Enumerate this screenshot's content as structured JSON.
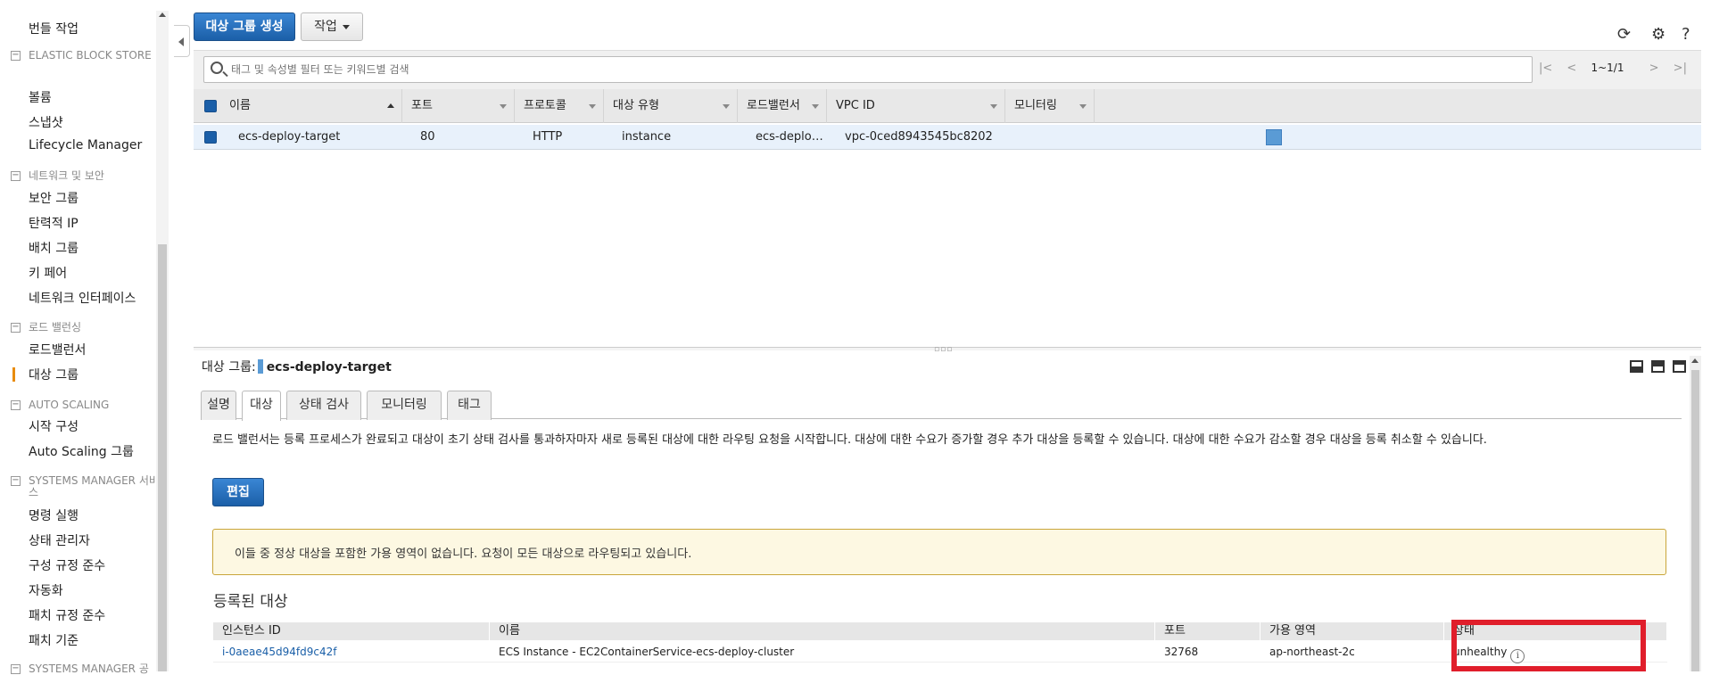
{
  "sidebar": {
    "items": [
      {
        "label": "번들 작업"
      },
      {
        "label": "볼륨"
      },
      {
        "label": "스냅샷"
      },
      {
        "label": "Lifecycle Manager"
      },
      {
        "label": "보안 그룹"
      },
      {
        "label": "탄력적 IP"
      },
      {
        "label": "배치 그룹"
      },
      {
        "label": "키 페어"
      },
      {
        "label": "네트워크 인터페이스"
      },
      {
        "label": "로드밸런서"
      },
      {
        "label": "대상 그룹",
        "active": true
      },
      {
        "label": "시작 구성"
      },
      {
        "label": "Auto Scaling 그룹"
      },
      {
        "label": "명령 실행"
      },
      {
        "label": "상태 관리자"
      },
      {
        "label": "구성 규정 준수"
      },
      {
        "label": "자동화"
      },
      {
        "label": "패치 규정 준수"
      },
      {
        "label": "패치 기준"
      }
    ],
    "sections": [
      {
        "label": "ELASTIC BLOCK STORE"
      },
      {
        "label": "네트워크 및 보안"
      },
      {
        "label": "로드 밸런싱"
      },
      {
        "label": "AUTO SCALING"
      },
      {
        "label": "SYSTEMS MANAGER 서비스"
      },
      {
        "label": "SYSTEMS MANAGER 공"
      }
    ]
  },
  "toolbar": {
    "create_label": "대상 그룹 생성",
    "actions_label": "작업",
    "icons": [
      "refresh-icon",
      "gear-icon",
      "help-icon"
    ]
  },
  "search": {
    "placeholder": "태그 및 속성별 필터 또는 키워드별 검색"
  },
  "pager": {
    "count": "1~1/1"
  },
  "target_groups": {
    "columns": [
      "이름",
      "포트",
      "프로토콜",
      "대상 유형",
      "로드밸런서",
      "VPC ID",
      "모니터링"
    ],
    "rows": [
      {
        "name": "ecs-deploy-target",
        "port": "80",
        "protocol": "HTTP",
        "target_type": "instance",
        "load_balancer": "ecs-deploy…",
        "vpc_id": "vpc-0ced8943545bc8202"
      }
    ]
  },
  "detail": {
    "title_prefix": "대상 그룹:",
    "title_name": "ecs-deploy-target",
    "tabs": [
      "설명",
      "대상",
      "상태 검사",
      "모니터링",
      "태그"
    ],
    "active_tab": "대상",
    "description": "로드 밸런서는 등록 프로세스가 완료되고 대상이 초기 상태 검사를 통과하자마자 새로 등록된 대상에 대한 라우팅 요청을 시작합니다. 대상에 대한 수요가 증가할 경우 추가 대상을 등록할 수 있습니다. 대상에 대한 수요가 감소할 경우 대상을 등록 취소할 수 있습니다.",
    "edit_label": "편집",
    "warning": "이들 중 정상 대상을 포함한 가용 영역이 없습니다. 요청이 모든 대상으로 라우팅되고 있습니다.",
    "registered_title": "등록된 대상",
    "registered_columns": [
      "인스턴스 ID",
      "이름",
      "포트",
      "가용 영역",
      "상태"
    ],
    "registered_rows": [
      {
        "instance_id": "i-0aeae45d94fd9c42f",
        "name": "ECS Instance - EC2ContainerService-ecs-deploy-cluster",
        "port": "32768",
        "az": "ap-northeast-2c",
        "status": "unhealthy"
      }
    ]
  },
  "colors": {
    "primary": "#1b5fa8",
    "highlight": "#e01e2b",
    "warning_bg": "#fdf8e2",
    "active_marker": "#e88c0e"
  }
}
